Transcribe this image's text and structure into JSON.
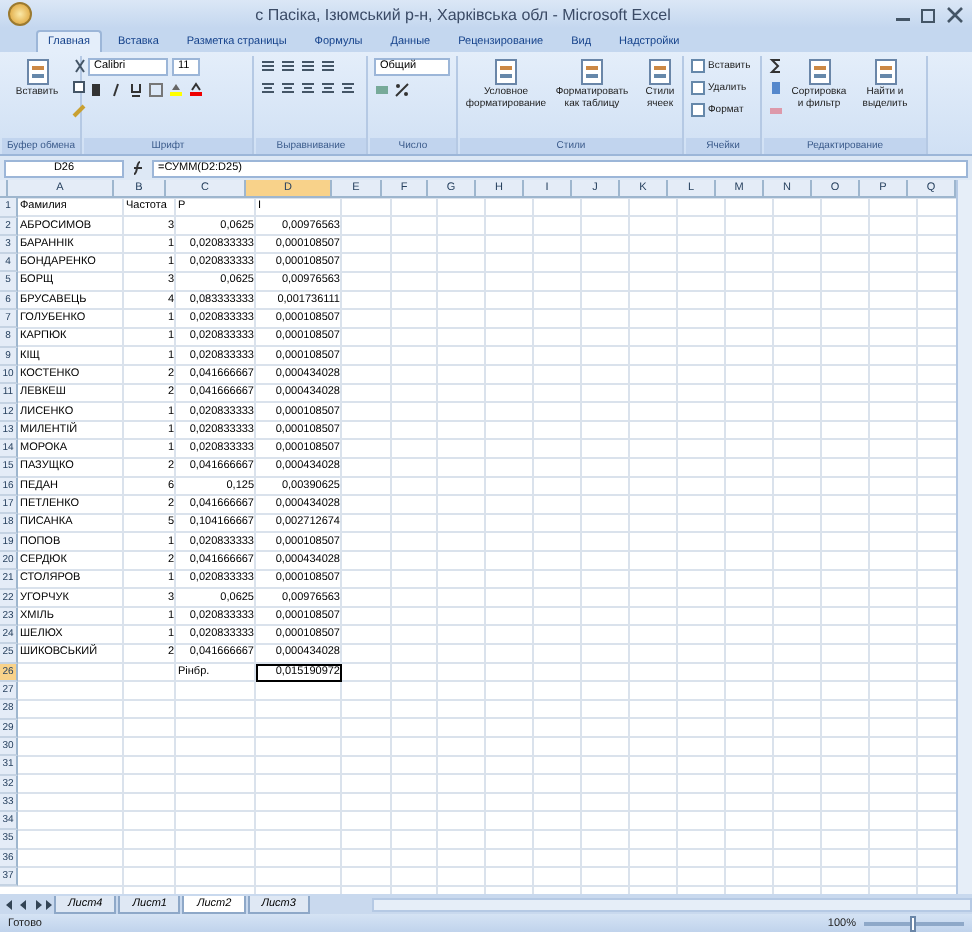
{
  "window": {
    "title": "с Пасіка, Ізюмський р-н, Харківська обл - Microsoft Excel"
  },
  "tabs": [
    {
      "label": "Главная",
      "selected": true
    },
    {
      "label": "Вставка",
      "selected": false
    },
    {
      "label": "Разметка страницы",
      "selected": false
    },
    {
      "label": "Формулы",
      "selected": false
    },
    {
      "label": "Данные",
      "selected": false
    },
    {
      "label": "Рецензирование",
      "selected": false
    },
    {
      "label": "Вид",
      "selected": false
    },
    {
      "label": "Надстройки",
      "selected": false
    }
  ],
  "ribbon": {
    "paste": "Вставить",
    "font_name": "Calibri",
    "font_size": "11",
    "number_format": "Общий",
    "style_buttons": [
      "Условное форматирование",
      "Форматировать как таблицу",
      "Стили ячеек"
    ],
    "cell_buttons": [
      "Вставить",
      "Удалить",
      "Формат"
    ],
    "edit_buttons": [
      "Сортировка и фильтр",
      "Найти и выделить"
    ],
    "groups": [
      "Буфер обмена",
      "Шрифт",
      "Выравнивание",
      "Число",
      "Стили",
      "Ячейки",
      "Редактирование"
    ]
  },
  "formula_bar": {
    "name_box": "D26",
    "formula": "=СУММ(D2:D25)"
  },
  "columns": [
    {
      "label": "A",
      "selected": false
    },
    {
      "label": "B",
      "selected": false
    },
    {
      "label": "C",
      "selected": false
    },
    {
      "label": "D",
      "selected": true
    },
    {
      "label": "E",
      "selected": false
    },
    {
      "label": "F",
      "selected": false
    },
    {
      "label": "G",
      "selected": false
    },
    {
      "label": "H",
      "selected": false
    },
    {
      "label": "I",
      "selected": false
    },
    {
      "label": "J",
      "selected": false
    },
    {
      "label": "K",
      "selected": false
    },
    {
      "label": "L",
      "selected": false
    },
    {
      "label": "M",
      "selected": false
    },
    {
      "label": "N",
      "selected": false
    },
    {
      "label": "O",
      "selected": false
    },
    {
      "label": "P",
      "selected": false
    },
    {
      "label": "Q",
      "selected": false
    }
  ],
  "rows": [
    {
      "num": "1",
      "selected": false,
      "cells": [
        "Фамилия",
        "Частота",
        "P",
        "I"
      ]
    },
    {
      "num": "2",
      "selected": false,
      "cells": [
        "АБРОСИМОВ",
        "3",
        "0,0625",
        "0,00976563"
      ]
    },
    {
      "num": "3",
      "selected": false,
      "cells": [
        "БАРАННІК",
        "1",
        "0,020833333",
        "0,000108507"
      ]
    },
    {
      "num": "4",
      "selected": false,
      "cells": [
        "БОНДАРЕНКО",
        "1",
        "0,020833333",
        "0,000108507"
      ]
    },
    {
      "num": "5",
      "selected": false,
      "cells": [
        "БОРЩ",
        "3",
        "0,0625",
        "0,00976563"
      ]
    },
    {
      "num": "6",
      "selected": false,
      "cells": [
        "БРУСАВЕЦЬ",
        "4",
        "0,083333333",
        "0,001736111"
      ]
    },
    {
      "num": "7",
      "selected": false,
      "cells": [
        "ГОЛУБЕНКО",
        "1",
        "0,020833333",
        "0,000108507"
      ]
    },
    {
      "num": "8",
      "selected": false,
      "cells": [
        "КАРПЮК",
        "1",
        "0,020833333",
        "0,000108507"
      ]
    },
    {
      "num": "9",
      "selected": false,
      "cells": [
        "КІЩ",
        "1",
        "0,020833333",
        "0,000108507"
      ]
    },
    {
      "num": "10",
      "selected": false,
      "cells": [
        "КОСТЕНКО",
        "2",
        "0,041666667",
        "0,000434028"
      ]
    },
    {
      "num": "11",
      "selected": false,
      "cells": [
        "ЛЕВКЕШ",
        "2",
        "0,041666667",
        "0,000434028"
      ]
    },
    {
      "num": "12",
      "selected": false,
      "cells": [
        "ЛИСЕНКО",
        "1",
        "0,020833333",
        "0,000108507"
      ]
    },
    {
      "num": "13",
      "selected": false,
      "cells": [
        "МИЛЕНТІЙ",
        "1",
        "0,020833333",
        "0,000108507"
      ]
    },
    {
      "num": "14",
      "selected": false,
      "cells": [
        "МОРОКА",
        "1",
        "0,020833333",
        "0,000108507"
      ]
    },
    {
      "num": "15",
      "selected": false,
      "cells": [
        "ПАЗУЩКО",
        "2",
        "0,041666667",
        "0,000434028"
      ]
    },
    {
      "num": "16",
      "selected": false,
      "cells": [
        "ПЕДАН",
        "6",
        "0,125",
        "0,00390625"
      ]
    },
    {
      "num": "17",
      "selected": false,
      "cells": [
        "ПЕТЛЕНКО",
        "2",
        "0,041666667",
        "0,000434028"
      ]
    },
    {
      "num": "18",
      "selected": false,
      "cells": [
        "ПИСАНКА",
        "5",
        "0,104166667",
        "0,002712674"
      ]
    },
    {
      "num": "19",
      "selected": false,
      "cells": [
        "ПОПОВ",
        "1",
        "0,020833333",
        "0,000108507"
      ]
    },
    {
      "num": "20",
      "selected": false,
      "cells": [
        "СЕРДЮК",
        "2",
        "0,041666667",
        "0,000434028"
      ]
    },
    {
      "num": "21",
      "selected": false,
      "cells": [
        "СТОЛЯРОВ",
        "1",
        "0,020833333",
        "0,000108507"
      ]
    },
    {
      "num": "22",
      "selected": false,
      "cells": [
        "УГОРЧУК",
        "3",
        "0,0625",
        "0,00976563"
      ]
    },
    {
      "num": "23",
      "selected": false,
      "cells": [
        "ХМІЛЬ",
        "1",
        "0,020833333",
        "0,000108507"
      ]
    },
    {
      "num": "24",
      "selected": false,
      "cells": [
        "ШЕЛЮХ",
        "1",
        "0,020833333",
        "0,000108507"
      ]
    },
    {
      "num": "25",
      "selected": false,
      "cells": [
        "ШИКОВСЬКИЙ",
        "2",
        "0,041666667",
        "0,000434028"
      ]
    },
    {
      "num": "26",
      "selected": true,
      "cells": [
        null,
        null,
        "Рінбр.",
        "0,015190972"
      ]
    },
    {
      "num": "27",
      "selected": false
    },
    {
      "num": "28",
      "selected": false
    },
    {
      "num": "29",
      "selected": false
    },
    {
      "num": "30",
      "selected": false
    },
    {
      "num": "31",
      "selected": false
    },
    {
      "num": "32",
      "selected": false
    },
    {
      "num": "33",
      "selected": false
    },
    {
      "num": "34",
      "selected": false
    },
    {
      "num": "35",
      "selected": false
    },
    {
      "num": "36",
      "selected": false
    },
    {
      "num": "37",
      "selected": false
    }
  ],
  "sheets": [
    {
      "label": "Лист4",
      "selected": false
    },
    {
      "label": "Лист1",
      "selected": false
    },
    {
      "label": "Лист2",
      "selected": true
    },
    {
      "label": "Лист3",
      "selected": false
    }
  ],
  "status_bar": {
    "text": "Готово",
    "zoom": "100%",
    "level": 0.5
  }
}
